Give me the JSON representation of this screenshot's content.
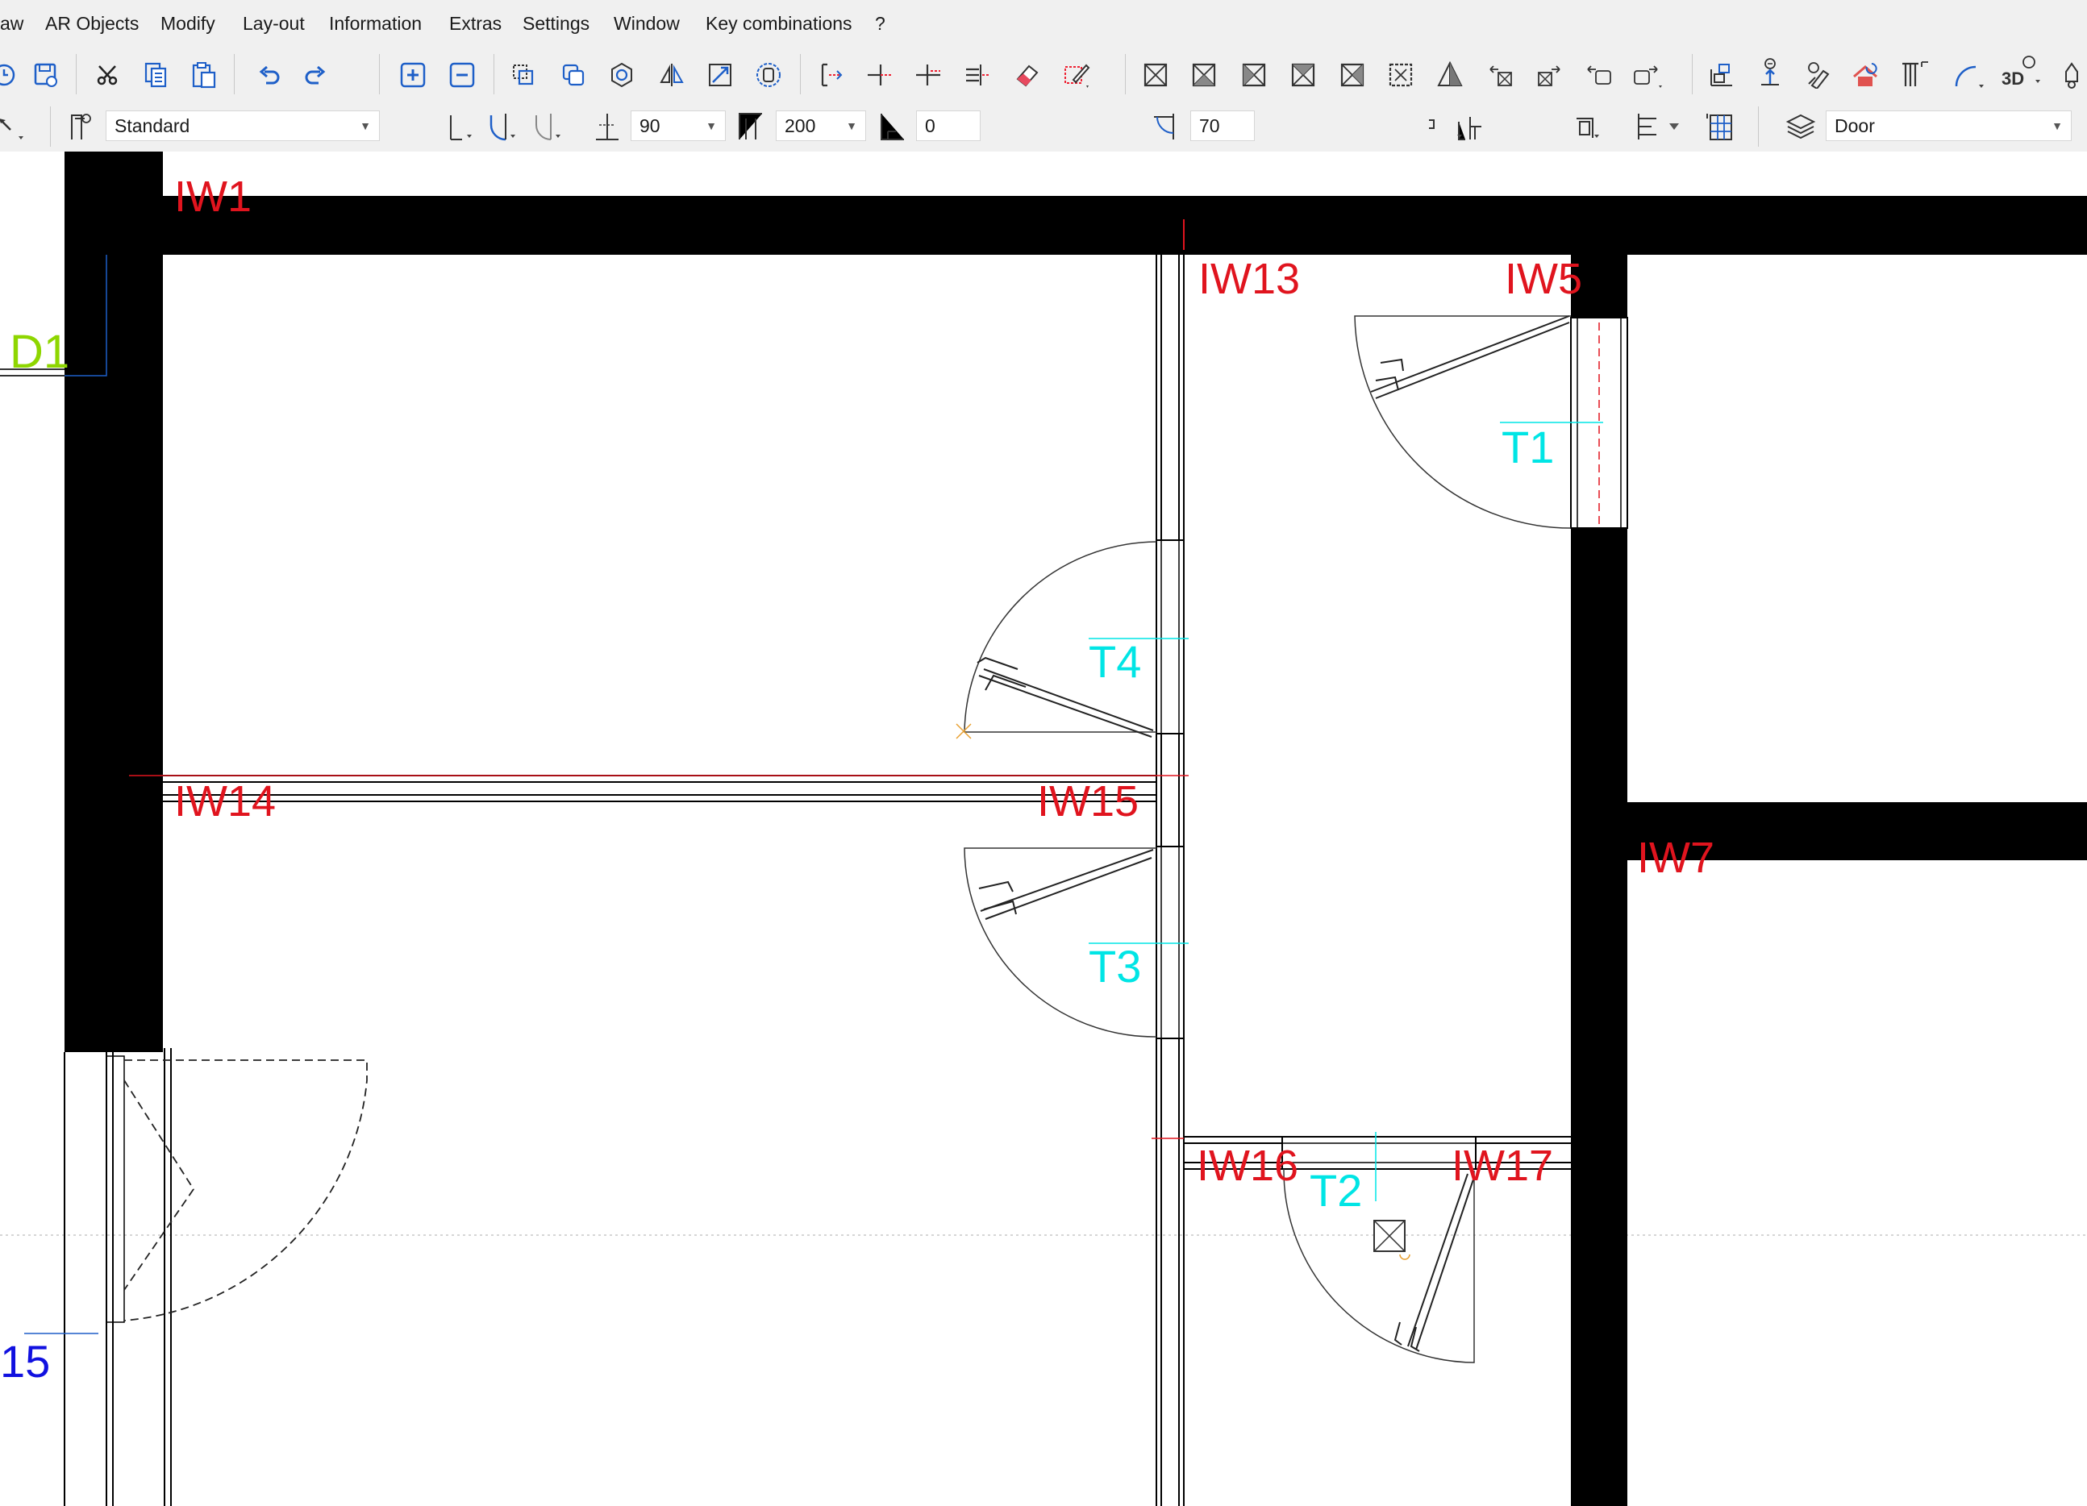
{
  "menu": [
    "aw",
    "AR Objects",
    "Modify",
    "Lay-out",
    "Information",
    "Extras",
    "Settings",
    "Window",
    "Key combinations",
    "?"
  ],
  "toolbar": {
    "icons": [
      "clock-icon",
      "save-icon",
      "cut-icon",
      "copy-icon",
      "paste-icon",
      "undo-icon",
      "redo-icon",
      "zoom-in-icon",
      "zoom-out-icon",
      "copy-objects-icon",
      "duplicate-icon",
      "rotate-icon",
      "mirror-icon",
      "scale-icon",
      "ortho-icon",
      "move-point-icon",
      "trim-icon",
      "extend-icon",
      "split-icon",
      "eraser-icon",
      "edit-pen-icon",
      "box-1-icon",
      "box-2-icon",
      "box-3-icon",
      "box-4-icon",
      "box-5-icon",
      "box-6-icon",
      "pyramid-icon",
      "move-left-icon",
      "move-right-icon",
      "move-left-2-icon",
      "move-right-2-icon",
      "copy-properties-icon",
      "elevation-icon",
      "paint-icon",
      "roof-icon",
      "column-icon",
      "arc-icon",
      "view-3d-icon",
      "light-icon"
    ],
    "view3d_label": "3D"
  },
  "options": {
    "style_value": "Standard",
    "angle_value": "90",
    "height_value": "200",
    "offset_value": "0",
    "width_value": "70",
    "layer_value": "Door"
  },
  "drawing": {
    "wall_labels": [
      "IW1",
      "IW13",
      "IW5",
      "IW14",
      "IW15",
      "IW7",
      "IW16",
      "IW17"
    ],
    "door_labels": [
      "T1",
      "T4",
      "T3",
      "T2"
    ],
    "other_labels": [
      "D1",
      "15"
    ],
    "colors": {
      "wall_label": "#e0141e",
      "door_label": "#00e5e5",
      "d1_label": "#8ed600",
      "num_label": "#1010e0",
      "wall_fill": "#000000",
      "background": "#ffffff",
      "accent_blue": "#1e5fc8"
    }
  }
}
